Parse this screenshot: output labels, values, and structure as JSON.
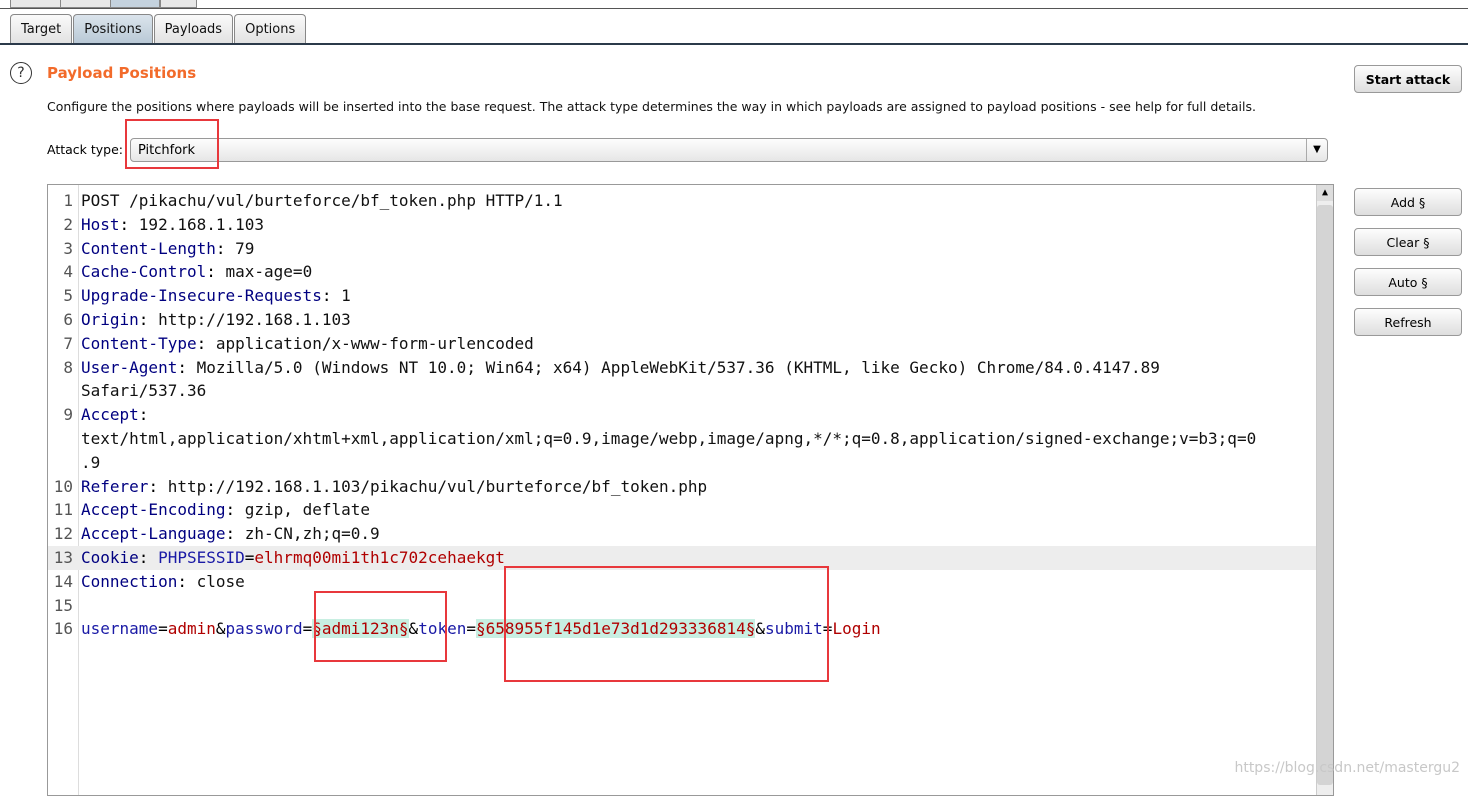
{
  "tabs": [
    "Target",
    "Positions",
    "Payloads",
    "Options"
  ],
  "active_tab": "Positions",
  "section": {
    "title": "Payload Positions",
    "description": "Configure the positions where payloads will be inserted into the base request. The attack type determines the way in which payloads are assigned to payload positions - see help for full details.",
    "help_icon": "?"
  },
  "attack_type": {
    "label": "Attack type:",
    "value": "Pitchfork"
  },
  "buttons": {
    "start": "Start attack",
    "add": "Add §",
    "clear": "Clear §",
    "auto": "Auto §",
    "refresh": "Refresh"
  },
  "request": {
    "l1": "POST /pikachu/vul/burteforce/bf_token.php HTTP/1.1",
    "headers": [
      {
        "n": "Host",
        "v": "192.168.1.103"
      },
      {
        "n": "Content-Length",
        "v": "79"
      },
      {
        "n": "Cache-Control",
        "v": "max-age=0"
      },
      {
        "n": "Upgrade-Insecure-Requests",
        "v": "1"
      },
      {
        "n": "Origin",
        "v": "http://192.168.1.103"
      },
      {
        "n": "Content-Type",
        "v": "application/x-www-form-urlencoded"
      },
      {
        "n": "User-Agent",
        "v": "Mozilla/5.0 (Windows NT 10.0; Win64; x64) AppleWebKit/537.36 (KHTML, like Gecko) Chrome/84.0.4147.89",
        "v2": "Safari/537.36"
      },
      {
        "n": "Accept",
        "v": "text/html,application/xhtml+xml,application/xml;q=0.9,image/webp,image/apng,*/*;q=0.8,application/signed-exchange;v=b3;q=0",
        "v2": ".9"
      },
      {
        "n": "Referer",
        "v": "http://192.168.1.103/pikachu/vul/burteforce/bf_token.php"
      },
      {
        "n": "Accept-Encoding",
        "v": "gzip, deflate"
      },
      {
        "n": "Accept-Language",
        "v": "zh-CN,zh;q=0.9"
      },
      {
        "n": "Cookie",
        "cn": "PHPSESSID",
        "cv": "elhrmq00mi1th1c702cehaekgt"
      },
      {
        "n": "Connection",
        "v": "close"
      }
    ],
    "body": {
      "k1": "username",
      "v1": "admin",
      "k2": "password",
      "v2": "§admi123n§",
      "k3": "token",
      "v3": "§658955f145d1e73d1d293336814§",
      "k4": "submit",
      "v4": "Login"
    }
  },
  "watermark": "https://blog.csdn.net/mastergu2"
}
